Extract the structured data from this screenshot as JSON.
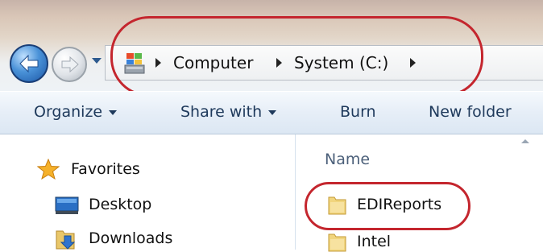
{
  "address_bar": {
    "breadcrumbs": [
      "Computer",
      "System (C:)"
    ]
  },
  "toolbar": {
    "organize_label": "Organize",
    "share_with_label": "Share with",
    "burn_label": "Burn",
    "new_folder_label": "New folder"
  },
  "navigation": {
    "favorites_label": "Favorites",
    "items": [
      {
        "label": "Desktop",
        "icon": "desktop-icon"
      },
      {
        "label": "Downloads",
        "icon": "downloads-icon"
      }
    ]
  },
  "file_list": {
    "column_header": "Name",
    "items": [
      {
        "label": "EDIReports",
        "icon": "folder-icon"
      },
      {
        "label": "Intel",
        "icon": "folder-icon"
      }
    ]
  },
  "colors": {
    "highlight_circle": "#c4262e",
    "toolbar_text": "#1e395b"
  }
}
